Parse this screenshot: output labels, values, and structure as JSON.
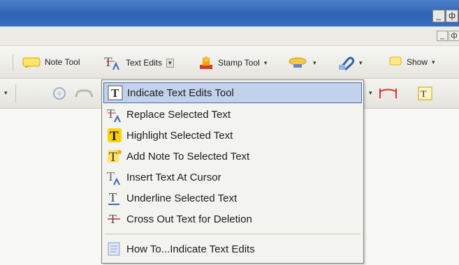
{
  "window": {
    "min_label": "_",
    "restore_label": "ф"
  },
  "menubar": {
    "min_label": "_",
    "restore_label": "ф"
  },
  "toolbar": {
    "note_tool": "Note Tool",
    "text_edits": "Text Edits",
    "stamp_tool": "Stamp Tool",
    "show": "Show",
    "dropdown_arrow": "▾"
  },
  "menu": {
    "items": [
      {
        "label": "Indicate Text Edits Tool",
        "icon": "text-edits-tool-icon"
      },
      {
        "label": "Replace Selected Text",
        "icon": "replace-text-icon"
      },
      {
        "label": "Highlight Selected Text",
        "icon": "highlight-text-icon"
      },
      {
        "label": "Add Note To Selected Text",
        "icon": "add-note-text-icon"
      },
      {
        "label": "Insert Text At Cursor",
        "icon": "insert-text-icon"
      },
      {
        "label": "Underline Selected Text",
        "icon": "underline-text-icon"
      },
      {
        "label": "Cross Out Text for Deletion",
        "icon": "cross-out-text-icon"
      },
      {
        "label": "How To...Indicate Text Edits",
        "icon": "help-icon"
      }
    ],
    "selected_index": 0
  },
  "colors": {
    "titlebar": "#2f63b3",
    "selection": "#c3d2ec",
    "accent_blue": "#3b63c9",
    "highlight_yellow": "#ffd200"
  }
}
